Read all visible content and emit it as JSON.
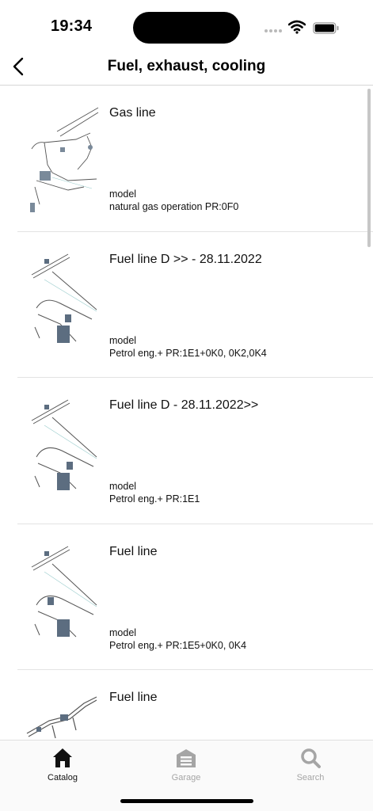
{
  "status": {
    "time": "19:34"
  },
  "nav": {
    "title": "Fuel, exhaust, cooling"
  },
  "items": [
    {
      "title": "Gas line",
      "model": "model",
      "detail": "natural gas operation PR:0F0"
    },
    {
      "title": "Fuel line D >> - 28.11.2022",
      "model": "model",
      "detail": "Petrol eng.+ PR:1E1+0K0, 0K2,0K4"
    },
    {
      "title": "Fuel line D - 28.11.2022>>",
      "model": "model",
      "detail": "Petrol eng.+ PR:1E1"
    },
    {
      "title": "Fuel line",
      "model": "model",
      "detail": "Petrol eng.+ PR:1E5+0K0, 0K4"
    },
    {
      "title": "Fuel line",
      "model": "",
      "detail": ""
    }
  ],
  "tabs": [
    {
      "label": "Catalog",
      "icon": "home-icon",
      "active": true
    },
    {
      "label": "Garage",
      "icon": "garage-icon",
      "active": false
    },
    {
      "label": "Search",
      "icon": "search-icon",
      "active": false
    }
  ],
  "colors": {
    "active_tab": "#111111",
    "inactive_tab": "#a5a5a5",
    "separator": "#e3e3e3"
  }
}
